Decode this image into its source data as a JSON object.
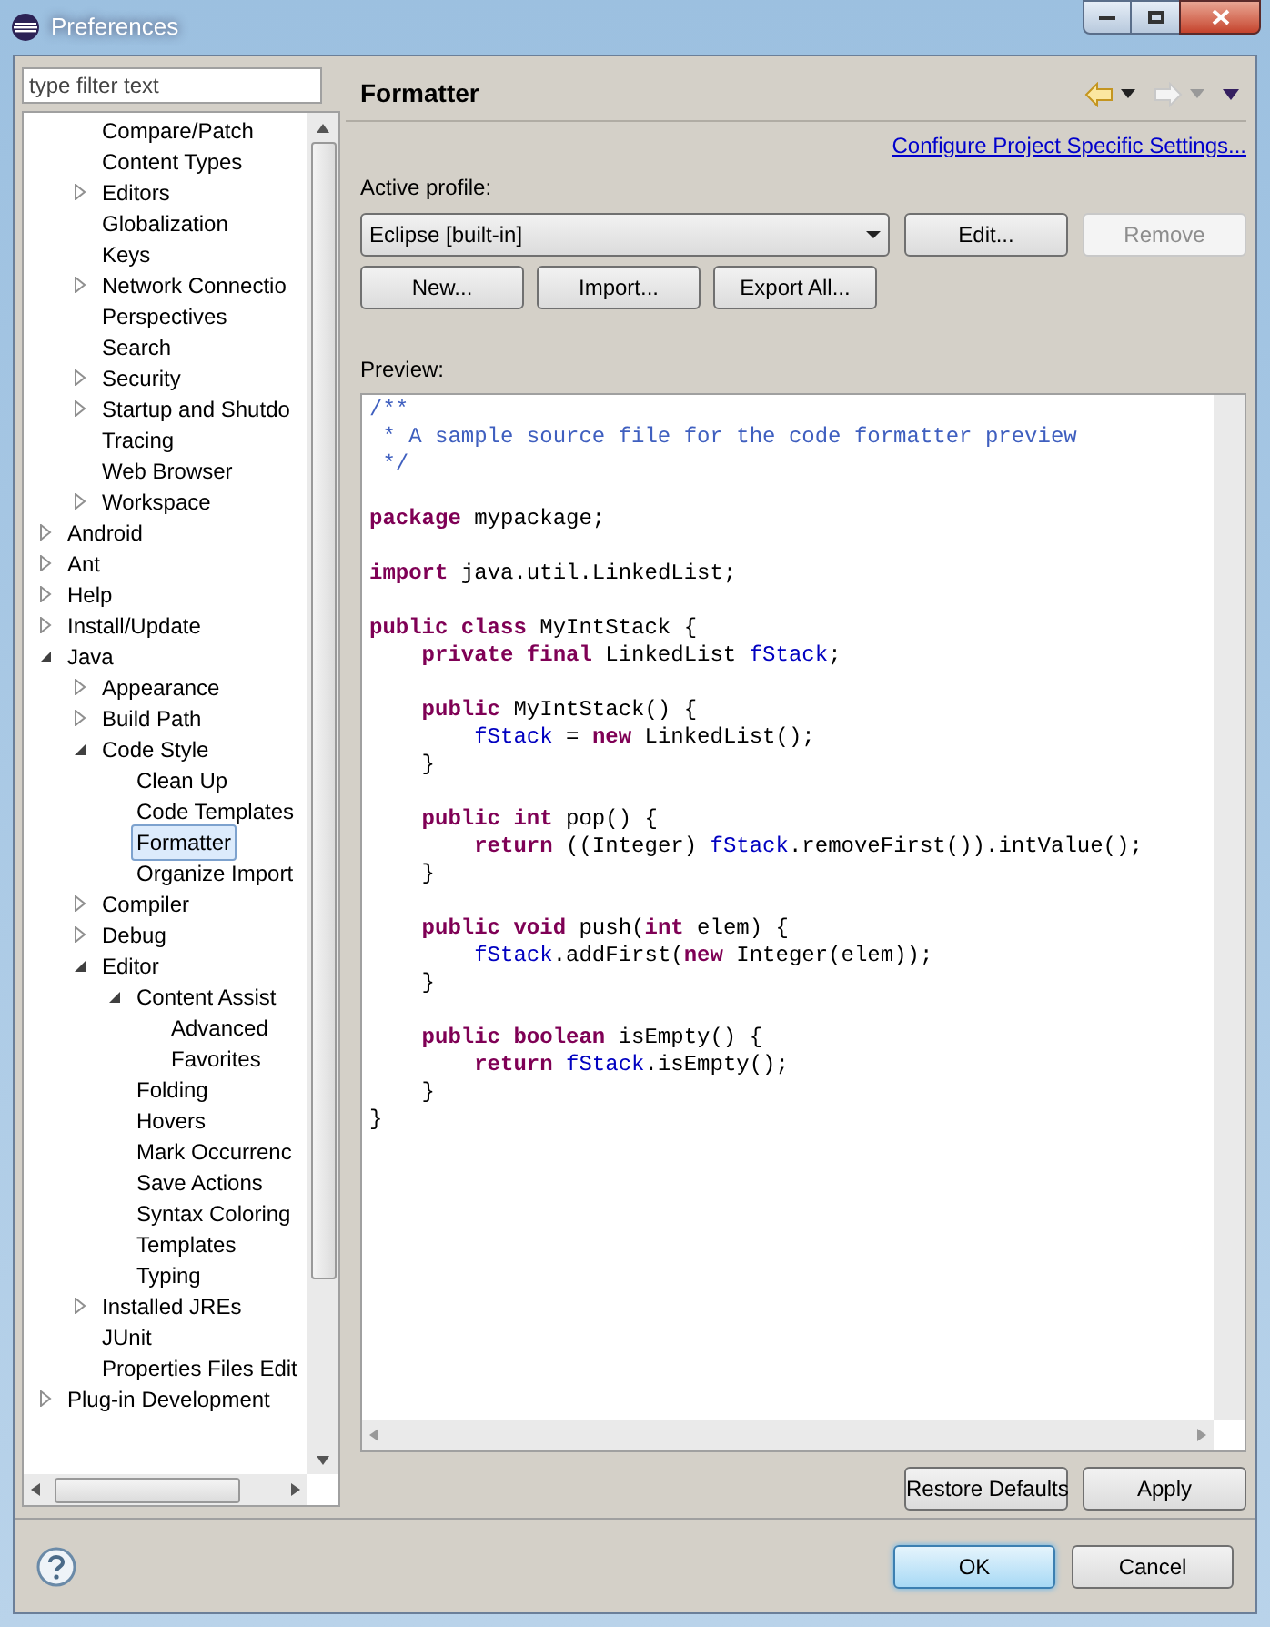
{
  "window": {
    "title": "Preferences"
  },
  "filter": {
    "placeholder": "type filter text"
  },
  "tree": {
    "scrolled_group": [
      {
        "label": "Compare/Patch",
        "selected": false
      },
      {
        "label": "Content Types",
        "selected": false
      },
      {
        "label": "Editors",
        "selected": false,
        "expanded": false
      },
      {
        "label": "Globalization",
        "selected": false
      },
      {
        "label": "Keys",
        "selected": false
      },
      {
        "label": "Network Connectio",
        "selected": false,
        "expanded": false
      },
      {
        "label": "Perspectives",
        "selected": false
      },
      {
        "label": "Search",
        "selected": false
      },
      {
        "label": "Security",
        "selected": false,
        "expanded": false
      },
      {
        "label": "Startup and Shutdo",
        "selected": false,
        "expanded": false
      },
      {
        "label": "Tracing",
        "selected": false
      },
      {
        "label": "Web Browser",
        "selected": false
      },
      {
        "label": "Workspace",
        "selected": false,
        "expanded": false
      }
    ],
    "items": [
      {
        "label": "Android",
        "selected": false,
        "expanded": false
      },
      {
        "label": "Ant",
        "selected": false,
        "expanded": false
      },
      {
        "label": "Help",
        "selected": false,
        "expanded": false
      },
      {
        "label": "Install/Update",
        "selected": false,
        "expanded": false
      },
      {
        "label": "Java",
        "selected": false,
        "expanded": true,
        "children": [
          {
            "label": "Appearance",
            "selected": false,
            "expanded": false
          },
          {
            "label": "Build Path",
            "selected": false,
            "expanded": false
          },
          {
            "label": "Code Style",
            "selected": false,
            "expanded": true,
            "children": [
              {
                "label": "Clean Up",
                "selected": false
              },
              {
                "label": "Code Templates",
                "selected": false
              },
              {
                "label": "Formatter",
                "selected": true
              },
              {
                "label": "Organize Import",
                "selected": false
              }
            ]
          },
          {
            "label": "Compiler",
            "selected": false,
            "expanded": false
          },
          {
            "label": "Debug",
            "selected": false,
            "expanded": false
          },
          {
            "label": "Editor",
            "selected": false,
            "expanded": true,
            "children": [
              {
                "label": "Content Assist",
                "selected": false,
                "expanded": true,
                "children": [
                  {
                    "label": "Advanced",
                    "selected": false
                  },
                  {
                    "label": "Favorites",
                    "selected": false
                  }
                ]
              },
              {
                "label": "Folding",
                "selected": false
              },
              {
                "label": "Hovers",
                "selected": false
              },
              {
                "label": "Mark Occurrenc",
                "selected": false
              },
              {
                "label": "Save Actions",
                "selected": false
              },
              {
                "label": "Syntax Coloring",
                "selected": false
              },
              {
                "label": "Templates",
                "selected": false
              },
              {
                "label": "Typing",
                "selected": false
              }
            ]
          },
          {
            "label": "Installed JREs",
            "selected": false,
            "expanded": false
          },
          {
            "label": "JUnit",
            "selected": false
          },
          {
            "label": "Properties Files Edit",
            "selected": false
          }
        ]
      },
      {
        "label": "Plug-in Development",
        "selected": false,
        "expanded": false
      }
    ]
  },
  "page": {
    "title": "Formatter",
    "link": "Configure Project Specific Settings...",
    "profile_label": "Active profile:",
    "profile_value": "Eclipse [built-in]",
    "profile_buttons": [
      {
        "label": "Edit...",
        "disabled": false
      },
      {
        "label": "Remove",
        "disabled": true
      }
    ],
    "buttons": [
      "New...",
      "Import...",
      "Export All..."
    ],
    "preview_label": "Preview:",
    "code": [
      {
        "kind": "code",
        "segments": [
          {
            "kind": "comment",
            "text": "/**"
          }
        ]
      },
      {
        "kind": "code",
        "segments": [
          {
            "kind": "comment",
            "text": " * A sample source file for the code formatter preview"
          }
        ]
      },
      {
        "kind": "code",
        "segments": [
          {
            "kind": "comment",
            "text": " */"
          }
        ]
      },
      {
        "kind": "blank"
      },
      {
        "kind": "code",
        "segments": [
          {
            "kind": "keyword",
            "text": "package"
          },
          {
            "kind": "plain",
            "text": " mypackage;"
          }
        ]
      },
      {
        "kind": "blank"
      },
      {
        "kind": "code",
        "segments": [
          {
            "kind": "keyword",
            "text": "import"
          },
          {
            "kind": "plain",
            "text": " java.util.LinkedList;"
          }
        ]
      },
      {
        "kind": "blank"
      },
      {
        "kind": "code",
        "segments": [
          {
            "kind": "keyword",
            "text": "public class"
          },
          {
            "kind": "plain",
            "text": " MyIntStack {"
          }
        ]
      },
      {
        "kind": "code",
        "segments": [
          {
            "kind": "keyword",
            "text": "    private final"
          },
          {
            "kind": "plain",
            "text": " LinkedList "
          },
          {
            "kind": "field",
            "text": "fStack"
          },
          {
            "kind": "plain",
            "text": ";"
          }
        ]
      },
      {
        "kind": "blank"
      },
      {
        "kind": "code",
        "segments": [
          {
            "kind": "keyword",
            "text": "    public"
          },
          {
            "kind": "plain",
            "text": " MyIntStack() {"
          }
        ]
      },
      {
        "kind": "code",
        "segments": [
          {
            "kind": "field",
            "text": "        fStack"
          },
          {
            "kind": "plain",
            "text": " = "
          },
          {
            "kind": "keyword",
            "text": "new"
          },
          {
            "kind": "plain",
            "text": " LinkedList();"
          }
        ]
      },
      {
        "kind": "code",
        "segments": [
          {
            "kind": "plain",
            "text": "    }"
          }
        ]
      },
      {
        "kind": "blank"
      },
      {
        "kind": "code",
        "segments": [
          {
            "kind": "keyword",
            "text": "    public int"
          },
          {
            "kind": "plain",
            "text": " pop() {"
          }
        ]
      },
      {
        "kind": "code",
        "segments": [
          {
            "kind": "keyword",
            "text": "        return"
          },
          {
            "kind": "plain",
            "text": " ((Integer) "
          },
          {
            "kind": "field",
            "text": "fStack"
          },
          {
            "kind": "plain",
            "text": ".removeFirst()).intValue();"
          }
        ]
      },
      {
        "kind": "code",
        "segments": [
          {
            "kind": "plain",
            "text": "    }"
          }
        ]
      },
      {
        "kind": "blank"
      },
      {
        "kind": "code",
        "segments": [
          {
            "kind": "keyword",
            "text": "    public void"
          },
          {
            "kind": "plain",
            "text": " push("
          },
          {
            "kind": "keyword",
            "text": "int"
          },
          {
            "kind": "plain",
            "text": " elem) {"
          }
        ]
      },
      {
        "kind": "code",
        "segments": [
          {
            "kind": "field",
            "text": "        fStack"
          },
          {
            "kind": "plain",
            "text": ".addFirst("
          },
          {
            "kind": "keyword",
            "text": "new"
          },
          {
            "kind": "plain",
            "text": " Integer(elem));"
          }
        ]
      },
      {
        "kind": "code",
        "segments": [
          {
            "kind": "plain",
            "text": "    }"
          }
        ]
      },
      {
        "kind": "blank"
      },
      {
        "kind": "code",
        "segments": [
          {
            "kind": "keyword",
            "text": "    public boolean"
          },
          {
            "kind": "plain",
            "text": " isEmpty() {"
          }
        ]
      },
      {
        "kind": "code",
        "segments": [
          {
            "kind": "keyword",
            "text": "        return"
          },
          {
            "kind": "field",
            "text": " fStack"
          },
          {
            "kind": "plain",
            "text": ".isEmpty();"
          }
        ]
      },
      {
        "kind": "code",
        "segments": [
          {
            "kind": "plain",
            "text": "    }"
          }
        ]
      },
      {
        "kind": "code",
        "segments": [
          {
            "kind": "plain",
            "text": "}"
          }
        ]
      }
    ],
    "footer_buttons": [
      "Restore Defaults",
      "Apply"
    ]
  },
  "dialog_buttons": [
    {
      "label": "OK",
      "default": true
    },
    {
      "label": "Cancel",
      "default": false
    }
  ]
}
